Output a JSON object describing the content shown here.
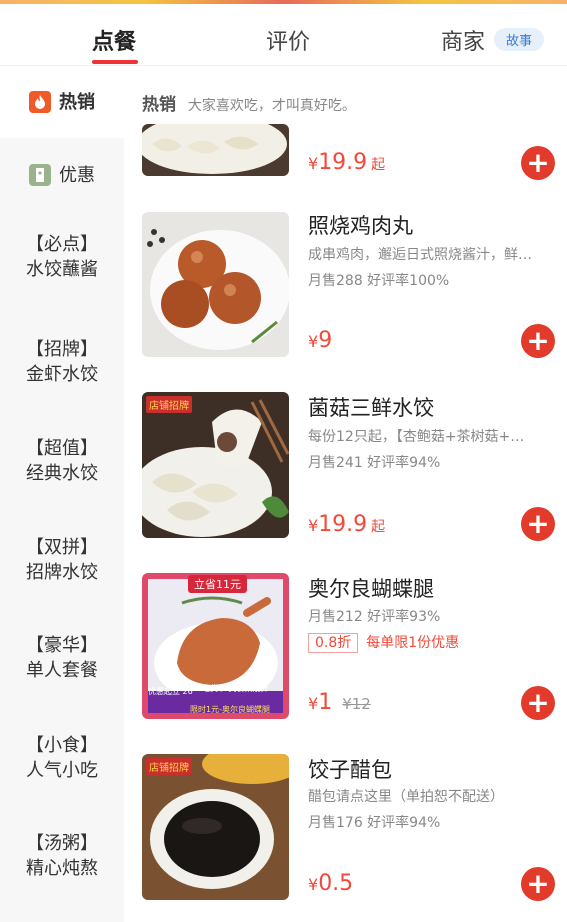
{
  "tabs": [
    {
      "label": "点餐"
    },
    {
      "label": "评价"
    },
    {
      "label": "商家"
    }
  ],
  "tab_badge": "故事",
  "sidebar": {
    "items": [
      {
        "line1": "热销",
        "line2": ""
      },
      {
        "line1": "优惠",
        "line2": ""
      },
      {
        "line1": "【必点】",
        "line2": "水饺蘸酱"
      },
      {
        "line1": "【招牌】",
        "line2": "金虾水饺"
      },
      {
        "line1": "【超值】",
        "line2": "经典水饺"
      },
      {
        "line1": "【双拼】",
        "line2": "招牌水饺"
      },
      {
        "line1": "【豪华】",
        "line2": "单人套餐"
      },
      {
        "line1": "【小食】",
        "line2": "人气小吃"
      },
      {
        "line1": "【汤粥】",
        "line2": "精心炖熬"
      }
    ]
  },
  "section": {
    "title": "热销",
    "subtitle": "大家喜欢吃，才叫真好吃。"
  },
  "items": [
    {
      "title": "",
      "desc": "",
      "stats": "",
      "price_cur": "¥",
      "price": "19.9",
      "suffix": "起",
      "orig": ""
    },
    {
      "title": "照烧鸡肉丸",
      "desc": "成串鸡肉，邂逅日式照烧酱汁，鲜…",
      "stats": "月售288  好评率100%",
      "price_cur": "¥",
      "price": "9",
      "suffix": "",
      "orig": ""
    },
    {
      "title": "菌菇三鲜水饺",
      "desc": "每份12只起，【杏鲍菇+茶树菇+…",
      "stats": "月售241  好评率94%",
      "price_cur": "¥",
      "price": "19.9",
      "suffix": "起",
      "orig": "",
      "thumb_tag": "店铺招牌"
    },
    {
      "title": "奥尔良蝴蝶腿",
      "desc": "",
      "stats": "月售212  好评率93%",
      "discount_box": "0.8折",
      "discount_text": "每单限1份优惠",
      "price_cur": "¥",
      "price": "1",
      "suffix": "",
      "orig": "¥12",
      "thumb_tag": "立省11元",
      "thumb_footer_left": "优惠起立 26",
      "thumb_footer_right": "吃货节·美食聚划算",
      "thumb_footer_bottom": "限时1元-奥尔良蝴蝶腿"
    },
    {
      "title": "饺子醋包",
      "desc": "醋包请点这里（单拍恕不配送）",
      "stats": "月售176  好评率94%",
      "price_cur": "¥",
      "price": "0.5",
      "suffix": "",
      "orig": "",
      "thumb_tag": "店铺招牌"
    }
  ],
  "colors": {
    "accent": "#e23a2b",
    "price": "#f04a3a"
  }
}
